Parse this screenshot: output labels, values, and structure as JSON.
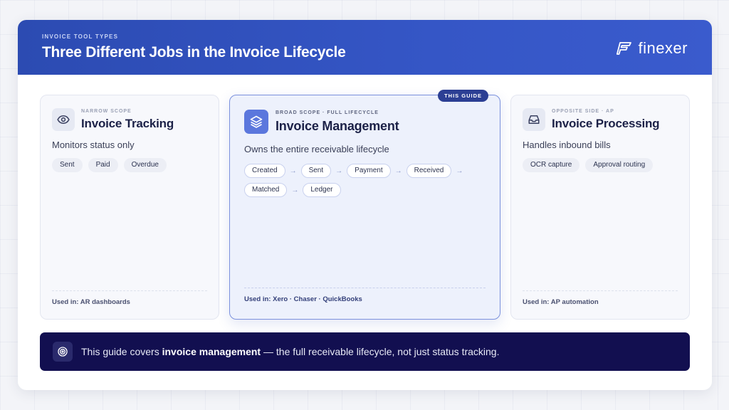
{
  "header": {
    "eyebrow": "INVOICE TOOL TYPES",
    "title": "Three Different Jobs in the Invoice Lifecycle",
    "brand": "finexer"
  },
  "cards": {
    "tracking": {
      "icon": "eye-icon",
      "eyebrow": "NARROW SCOPE",
      "title": "Invoice Tracking",
      "description": "Monitors status only",
      "chips": [
        "Sent",
        "Paid",
        "Overdue"
      ],
      "used_in": "Used in: AR dashboards"
    },
    "management": {
      "badge": "THIS GUIDE",
      "icon": "layers-icon",
      "eyebrow": "BROAD SCOPE · FULL LIFECYCLE",
      "title": "Invoice Management",
      "description": "Owns the entire receivable lifecycle",
      "flow": [
        "Created",
        "Sent",
        "Payment",
        "Received",
        "Matched",
        "Ledger"
      ],
      "used_in": "Used in: Xero · Chaser · QuickBooks"
    },
    "processing": {
      "icon": "inbox-icon",
      "eyebrow": "OPPOSITE SIDE · AP",
      "title": "Invoice Processing",
      "description": "Handles inbound bills",
      "chips": [
        "OCR capture",
        "Approval routing"
      ],
      "used_in": "Used in: AP automation"
    }
  },
  "banner": {
    "icon": "target-icon",
    "prefix": "This guide covers ",
    "emphasis": "invoice management",
    "suffix": " — the full receivable lifecycle, not just status tracking."
  },
  "colors": {
    "header": "#2c4bb2",
    "accent": "#5b77dd",
    "banner": "#120f50"
  }
}
